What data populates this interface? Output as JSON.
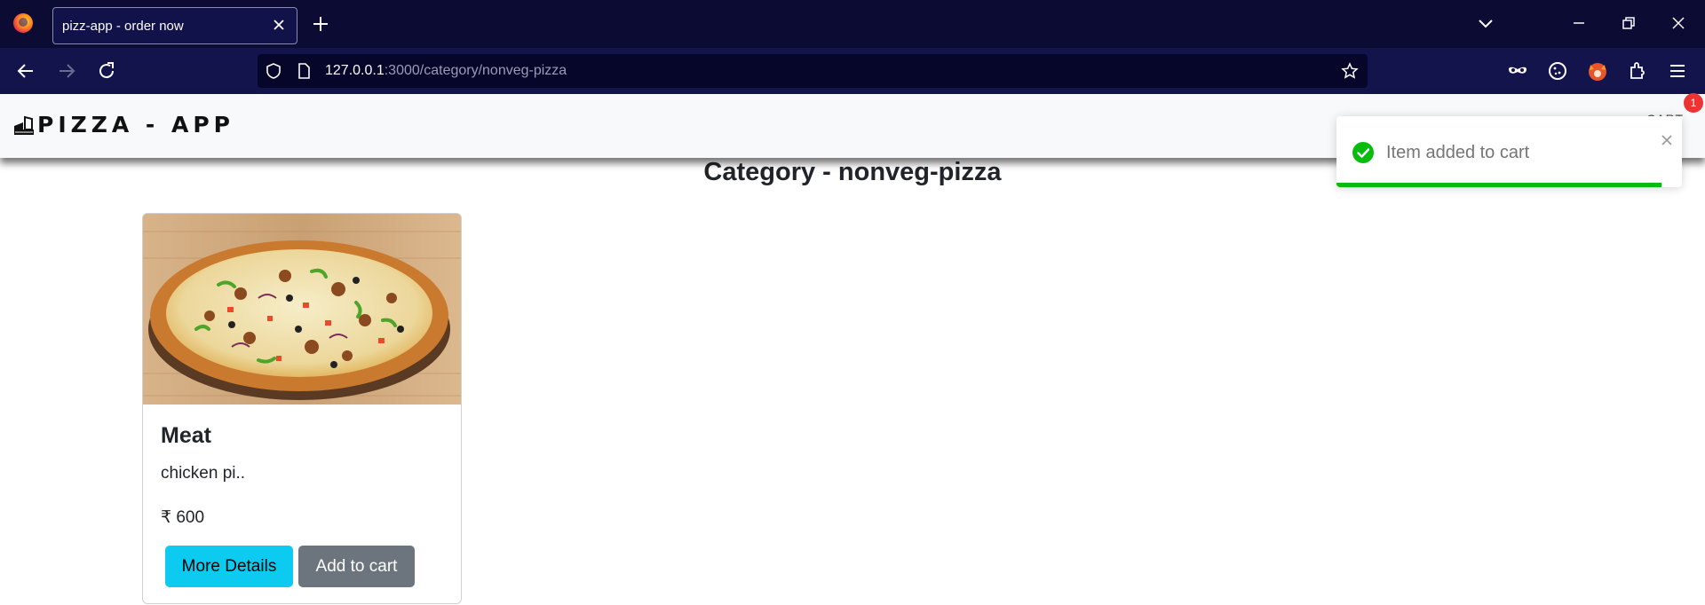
{
  "browser": {
    "tab_title": "pizz-app - order now",
    "url_host": "127.0.0.1",
    "url_path": ":3000/category/nonveg-pizza"
  },
  "header": {
    "brand": "PIZZA - APP",
    "cart_label": "CART",
    "cart_count": "1"
  },
  "main": {
    "category_title": "Category - nonveg-pizza",
    "products": [
      {
        "name": "Meat",
        "description": "chicken pi..",
        "price": "₹ 600",
        "details_label": "More Details",
        "add_label": "Add to cart"
      }
    ]
  },
  "toast": {
    "message": "Item added to cart",
    "progress": 0.94,
    "color": "#07bc0c"
  },
  "colors": {
    "details_button": "#0dcaf0",
    "cart_button": "#6c757d",
    "badge": "#e33333"
  },
  "icons": [
    "firefox-icon",
    "close-icon",
    "plus-icon",
    "chevron-down-icon",
    "minimize-icon",
    "restore-icon",
    "back-icon",
    "forward-icon",
    "reload-icon",
    "shield-icon",
    "page-icon",
    "star-icon",
    "mask-icon",
    "cookie-icon",
    "fox-icon",
    "extensions-icon",
    "menu-icon",
    "checkmark-circle-icon"
  ]
}
